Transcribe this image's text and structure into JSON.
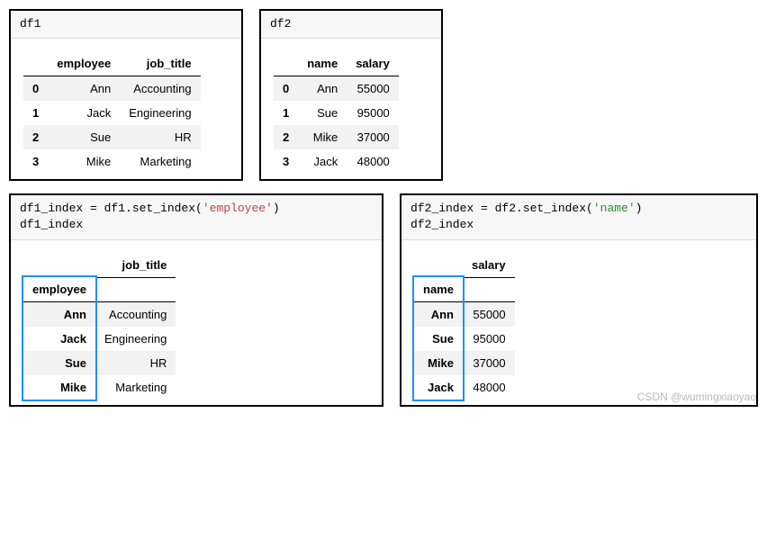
{
  "df1": {
    "label": "df1",
    "columns": [
      "employee",
      "job_title"
    ],
    "rows": [
      {
        "idx": "0",
        "employee": "Ann",
        "job_title": "Accounting"
      },
      {
        "idx": "1",
        "employee": "Jack",
        "job_title": "Engineering"
      },
      {
        "idx": "2",
        "employee": "Sue",
        "job_title": "HR"
      },
      {
        "idx": "3",
        "employee": "Mike",
        "job_title": "Marketing"
      }
    ]
  },
  "df2": {
    "label": "df2",
    "columns": [
      "name",
      "salary"
    ],
    "rows": [
      {
        "idx": "0",
        "name": "Ann",
        "salary": "55000"
      },
      {
        "idx": "1",
        "name": "Sue",
        "salary": "95000"
      },
      {
        "idx": "2",
        "name": "Mike",
        "salary": "37000"
      },
      {
        "idx": "3",
        "name": "Jack",
        "salary": "48000"
      }
    ]
  },
  "df1i": {
    "code_pre": "df1_index = df1.set_index(",
    "code_arg": "'employee'",
    "code_post": ")",
    "code_line2": "df1_index",
    "index_name": "employee",
    "col": "job_title",
    "rows": [
      {
        "idx": "Ann",
        "val": "Accounting"
      },
      {
        "idx": "Jack",
        "val": "Engineering"
      },
      {
        "idx": "Sue",
        "val": "HR"
      },
      {
        "idx": "Mike",
        "val": "Marketing"
      }
    ]
  },
  "df2i": {
    "code_pre": "df2_index = df2.set_index(",
    "code_arg": "'name'",
    "code_post": ")",
    "code_line2": "df2_index",
    "index_name": "name",
    "col": "salary",
    "rows": [
      {
        "idx": "Ann",
        "val": "55000"
      },
      {
        "idx": "Sue",
        "val": "95000"
      },
      {
        "idx": "Mike",
        "val": "37000"
      },
      {
        "idx": "Jack",
        "val": "48000"
      }
    ]
  },
  "watermark": "CSDN @wumingxiaoyao"
}
